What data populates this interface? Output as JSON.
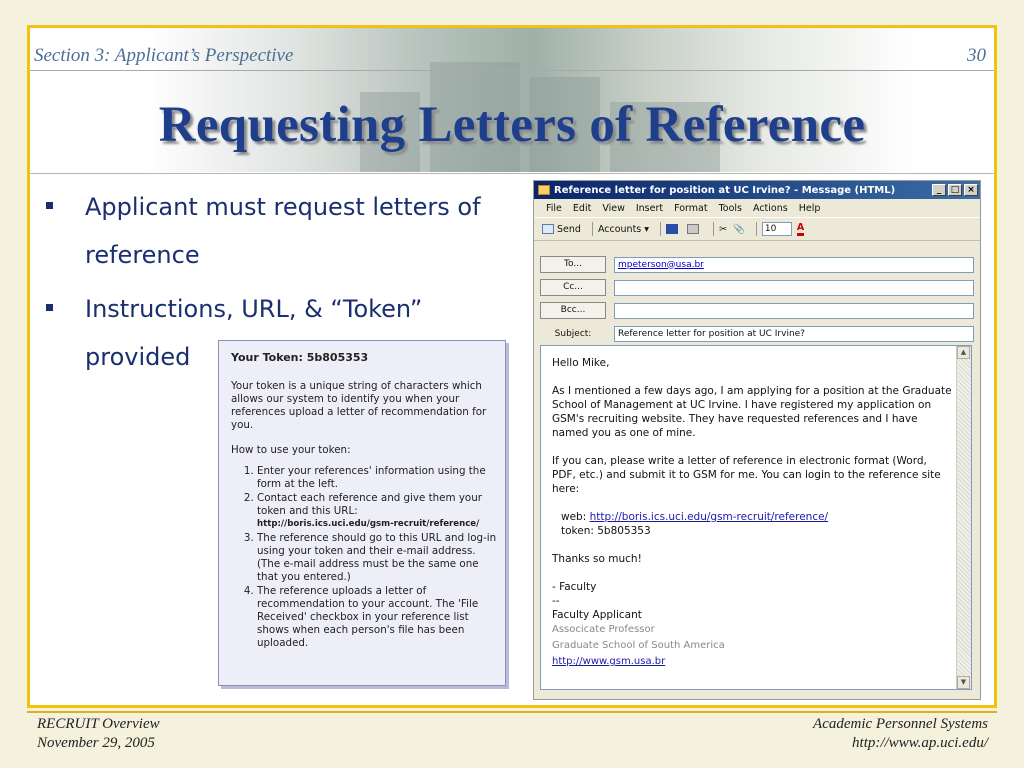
{
  "header": {
    "section_label": "Section 3: Applicant’s Perspective",
    "page_number": "30",
    "title": "Requesting Letters of Reference"
  },
  "bullets": [
    "Applicant must request letters of reference",
    "Instructions, URL, & “Token” provided"
  ],
  "token_box": {
    "title": "Your Token: 5b805353",
    "paragraph": "Your token is a unique string of characters which allows our system to identify you when your references upload a letter of recommendation for you.",
    "how_to": "How to use your token:",
    "steps": [
      "Enter your references' information using the form at the left.",
      "Contact each reference and give them your token and this URL:",
      "The reference should go to this URL and log-in using your token and their e-mail address. (The e-mail address must be the same one that you entered.)",
      "The reference uploads a letter of recommendation to your account. The 'File Received' checkbox in your reference list shows when each person's file has been uploaded."
    ],
    "url": "http://boris.ics.uci.edu/gsm-recruit/reference/"
  },
  "email_window": {
    "title": "Reference letter for position at UC Irvine? - Message (HTML)",
    "controls": [
      "_",
      "□",
      "×"
    ],
    "menu": [
      "File",
      "Edit",
      "View",
      "Insert",
      "Format",
      "Tools",
      "Actions",
      "Help"
    ],
    "toolbar": {
      "send": "Send",
      "accounts": "Accounts",
      "font_size": "10"
    },
    "to_button": "To...",
    "cc_button": "Cc...",
    "bcc_button": "Bcc...",
    "subject_label": "Subject:",
    "to_value": "mpeterson@usa.br",
    "cc_value": "",
    "bcc_value": "",
    "subject_value": "Reference letter for position at UC Irvine?",
    "body": {
      "greeting": "Hello Mike,",
      "p1": "As I mentioned a few days ago, I am applying for a position at the Graduate School of Management at UC Irvine.  I have registered my application on GSM's recruiting website.  They have requested references and I have named you as one of mine.",
      "p2": "If you can, please write a letter of reference in electronic format (Word, PDF, etc.) and submit it to GSM for me.  You can login to the reference site here:",
      "web_label": "web:",
      "web_url": "http://boris.ics.uci.edu/gsm-recruit/reference/",
      "token_line": "token: 5b805353",
      "thanks": "Thanks so much!",
      "sign": "- Faculty",
      "dashes": "--",
      "sig_name": "Faculty Applicant",
      "sig_title": "Associcate Professor",
      "sig_school": "Graduate School of South America",
      "sig_url": "http://www.gsm.usa.br"
    }
  },
  "footer": {
    "left_line1": "RECRUIT Overview",
    "left_line2": "November 29, 2005",
    "right_line1": "Academic Personnel Systems",
    "right_line2": "http://www.ap.uci.edu/"
  }
}
